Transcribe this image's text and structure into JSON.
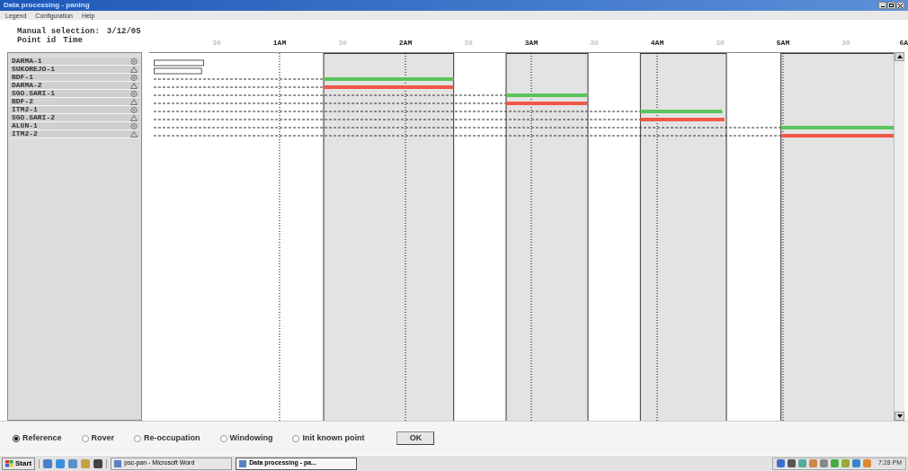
{
  "window": {
    "title": "Data processing - paning"
  },
  "menu": [
    "Legend",
    "Configuration",
    "Help"
  ],
  "header": {
    "selection_label": "Manual selection:",
    "selection_date": "3/12/05",
    "column_1": "Point id",
    "column_2": "Time"
  },
  "axis_labels": [
    "30",
    "1AM",
    "30",
    "2AM",
    "30",
    "3AM",
    "30",
    "4AM",
    "30",
    "5AM",
    "30",
    "6A"
  ],
  "points": [
    {
      "name": "DARMA-1",
      "kind": "circle"
    },
    {
      "name": "SUKOREJO-1",
      "kind": "triangle"
    },
    {
      "name": "BDF-1",
      "kind": "circle",
      "color": "#5cc45c"
    },
    {
      "name": "DARMA-2",
      "kind": "triangle",
      "color": "#f0584a"
    },
    {
      "name": "SGO.SARI-1",
      "kind": "circle",
      "color": "#5cc45c"
    },
    {
      "name": "BDF-2",
      "kind": "triangle",
      "color": "#f0584a"
    },
    {
      "name": "ITM2-1",
      "kind": "circle",
      "color": "#5cc45c"
    },
    {
      "name": "SGO.SARI-2",
      "kind": "triangle",
      "color": "#f0584a"
    },
    {
      "name": "ALUN-1",
      "kind": "circle",
      "color": "#5cc45c"
    },
    {
      "name": "ITM2-2",
      "kind": "triangle",
      "color": "#f0584a"
    }
  ],
  "modes": [
    {
      "label": "Reference",
      "selected": true
    },
    {
      "label": "Rover",
      "selected": false
    },
    {
      "label": "Re-occupation",
      "selected": false
    },
    {
      "label": "Windowing",
      "selected": false
    },
    {
      "label": "Init known point",
      "selected": false
    }
  ],
  "ok_button": "OK",
  "taskbar": {
    "start": "Start",
    "tasks": [
      {
        "label": "psc-pan - Microsoft Word",
        "selected": false
      },
      {
        "label": "Data processing - pa...",
        "selected": true
      }
    ],
    "clock": "7:28 PM"
  }
}
